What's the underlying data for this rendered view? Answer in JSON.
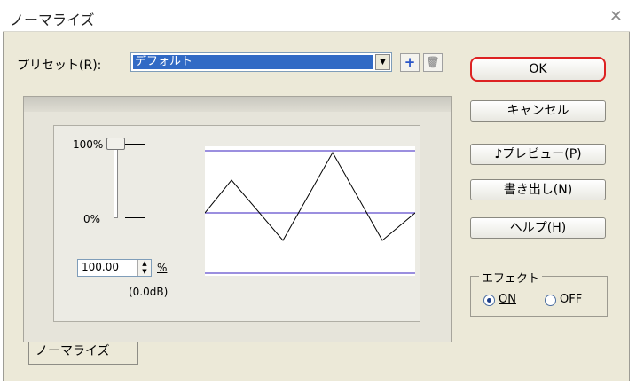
{
  "window": {
    "title": "ノーマライズ"
  },
  "preset": {
    "label": "プリセット(R):",
    "value": "デフォルト"
  },
  "icons": {
    "add": "plus-icon",
    "delete": "trash-icon",
    "close": "close-icon"
  },
  "slider": {
    "top_label": "100%",
    "bottom_label": "0%",
    "value": "100.00",
    "unit": "%",
    "db": "(0.0dB)",
    "level_percent": 100
  },
  "graph": {
    "line_color": "#9b8fdf",
    "wave_color": "#000000"
  },
  "buttons": {
    "ok": "OK",
    "cancel": "キャンセル",
    "preview": "♪プレビュー(P)",
    "export": "書き出し(N)",
    "help": "ヘルプ(H)"
  },
  "effect": {
    "label": "エフェクト",
    "on": "ON",
    "off": "OFF",
    "selected": "ON"
  },
  "tab": {
    "label": "ノーマライズ"
  },
  "colors": {
    "accent": "#316ac5",
    "ok_highlight": "#dd2222"
  }
}
